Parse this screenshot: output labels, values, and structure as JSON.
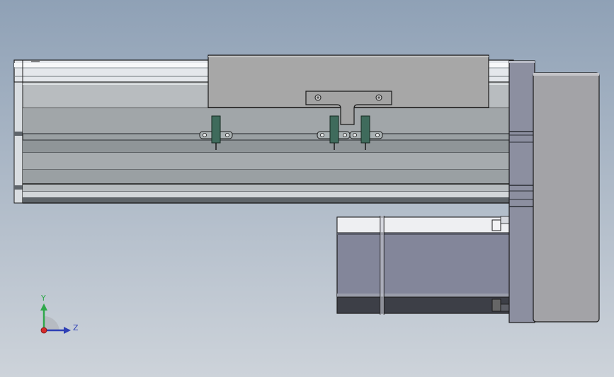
{
  "viewport": {
    "background_top": "#8fa1b6",
    "background_bottom": "#cdd3da"
  },
  "model": {
    "parts": [
      "linear-actuator-body",
      "guide-rail",
      "slide-carriage",
      "mounting-bracket",
      "limit-sensors",
      "end-plate",
      "servo-motor",
      "motor-flange"
    ],
    "colors": {
      "body": "#9aa0a3",
      "body_dark": "#7d8386",
      "rail": "#e2e6ea",
      "carriage": "#a6a6a6",
      "end_plate": "#8c8fa0",
      "motor": "#83869a",
      "motor_dark": "#3d3f47",
      "sensor": "#3f6b5c",
      "edge": "#1a1a1a"
    }
  },
  "triad": {
    "y_label": "Y",
    "z_label": "Z",
    "y_color": "#2ea84a",
    "z_color": "#2d3fb5",
    "x_color": "#d62b2b"
  }
}
